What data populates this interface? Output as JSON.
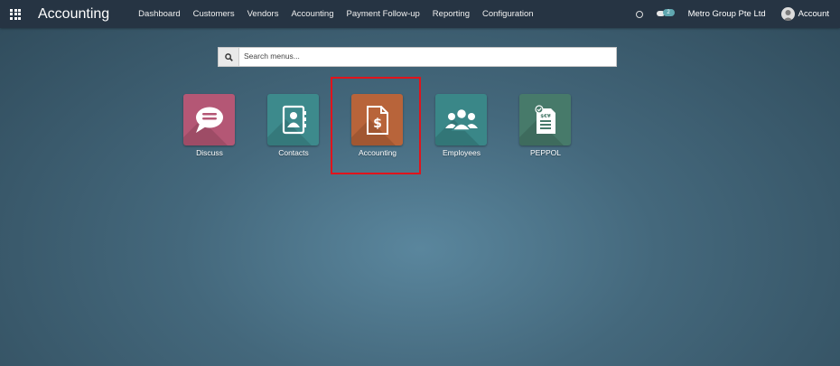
{
  "topbar": {
    "app_title": "Accounting",
    "menu": [
      "Dashboard",
      "Customers",
      "Vendors",
      "Accounting",
      "Payment Follow-up",
      "Reporting",
      "Configuration"
    ],
    "chat_badge": "2",
    "company": "Metro Group Pte Ltd",
    "account": "Account"
  },
  "search": {
    "placeholder": "Search menus..."
  },
  "apps": [
    {
      "label": "Discuss",
      "color": "#b45775",
      "icon": "speech-bubble-icon"
    },
    {
      "label": "Contacts",
      "color": "#3d8a8c",
      "icon": "address-book-icon"
    },
    {
      "label": "Accounting",
      "color": "#b8643a",
      "icon": "invoice-dollar-icon"
    },
    {
      "label": "Employees",
      "color": "#3a8788",
      "icon": "users-group-icon"
    },
    {
      "label": "PEPPOL",
      "color": "#477a6a",
      "icon": "einvoice-icon"
    }
  ],
  "highlight_color": "#e0141c"
}
